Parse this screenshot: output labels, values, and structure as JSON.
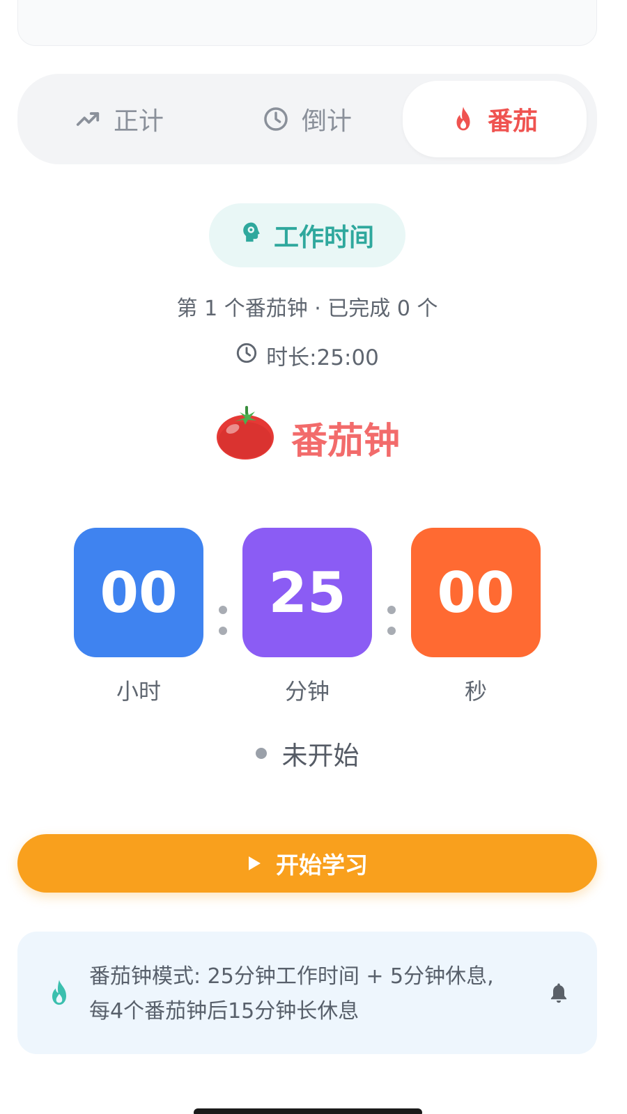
{
  "tabs": [
    {
      "label": "正计",
      "icon": "trending-up-icon"
    },
    {
      "label": "倒计",
      "icon": "clock-icon"
    },
    {
      "label": "番茄",
      "icon": "flame-icon",
      "active": true
    }
  ],
  "phase": {
    "label": "工作时间",
    "icon": "brain-gear-icon",
    "color": "#2fa89d"
  },
  "session_info": "第 1 个番茄钟 · 已完成 0 个",
  "duration": {
    "icon": "clock-icon",
    "text": "时长:25:00"
  },
  "mode_title": {
    "emoji": "🍅",
    "text": "番茄钟",
    "color": "#f26b6b"
  },
  "timer": {
    "hours": {
      "value": "00",
      "label": "小时",
      "color": "#3f83f0"
    },
    "minutes": {
      "value": "25",
      "label": "分钟",
      "color": "#8b5cf4"
    },
    "seconds": {
      "value": "00",
      "label": "秒",
      "color": "#ff6a32"
    }
  },
  "status": {
    "text": "未开始",
    "dot_color": "#9aa0a9"
  },
  "start_button": {
    "label": "开始学习",
    "icon": "play-icon",
    "color": "#f9a01d"
  },
  "info": {
    "line1": "番茄钟模式: 25分钟工作时间 + 5分钟休息,",
    "line2": "每4个番茄钟后15分钟长休息",
    "left_icon": "flame-icon",
    "right_icon": "bell-icon"
  }
}
